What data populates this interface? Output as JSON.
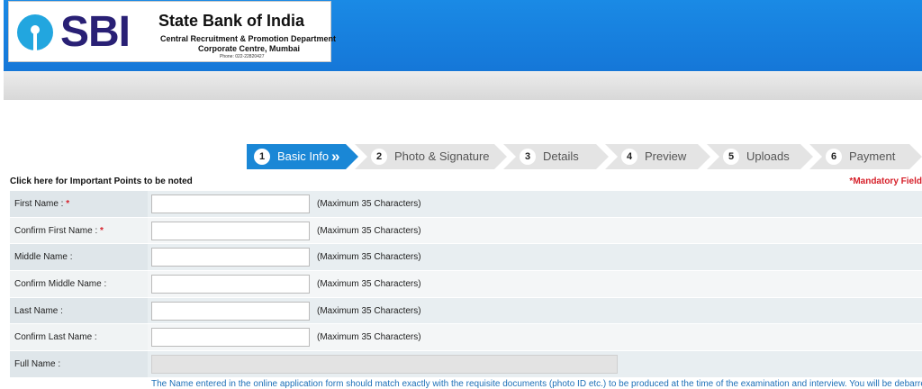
{
  "header": {
    "logo_text": "SBI",
    "bank_name": "State Bank of India",
    "department": "Central Recruitment & Promotion Department",
    "centre": "Corporate Centre, Mumbai",
    "phone": "Phone: 022-22820427"
  },
  "steps": [
    {
      "num": "1",
      "label": "Basic Info",
      "active": true
    },
    {
      "num": "2",
      "label": "Photo & Signature",
      "active": false
    },
    {
      "num": "3",
      "label": "Details",
      "active": false
    },
    {
      "num": "4",
      "label": "Preview",
      "active": false
    },
    {
      "num": "5",
      "label": "Uploads",
      "active": false
    },
    {
      "num": "6",
      "label": "Payment",
      "active": false
    }
  ],
  "important_link": "Click here for Important Points to be noted",
  "mandatory_note": "*Mandatory Field",
  "form": {
    "rows": [
      {
        "label": "First Name :",
        "required": "*",
        "value": "",
        "hint": "(Maximum 35 Characters)"
      },
      {
        "label": "Confirm First Name :",
        "required": "*",
        "value": "",
        "hint": "(Maximum 35 Characters)"
      },
      {
        "label": "Middle Name :",
        "required": "",
        "value": "",
        "hint": "(Maximum 35 Characters)"
      },
      {
        "label": "Confirm Middle Name :",
        "required": "",
        "value": "",
        "hint": "(Maximum 35 Characters)"
      },
      {
        "label": "Last Name :",
        "required": "",
        "value": "",
        "hint": "(Maximum 35 Characters)"
      },
      {
        "label": "Confirm Last Name :",
        "required": "",
        "value": "",
        "hint": "(Maximum 35 Characters)"
      }
    ],
    "full_name_label": "Full Name :",
    "full_name_value": "",
    "name_note": "The Name entered in the online application form should match exactly with the requisite documents (photo ID etc.) to be produced at the time of the examination and interview. You will be debarred"
  },
  "colors": {
    "header_blue": "#1577d8",
    "step_active": "#1a87d6",
    "required_red": "#d6202a",
    "note_blue": "#1d70b8"
  }
}
